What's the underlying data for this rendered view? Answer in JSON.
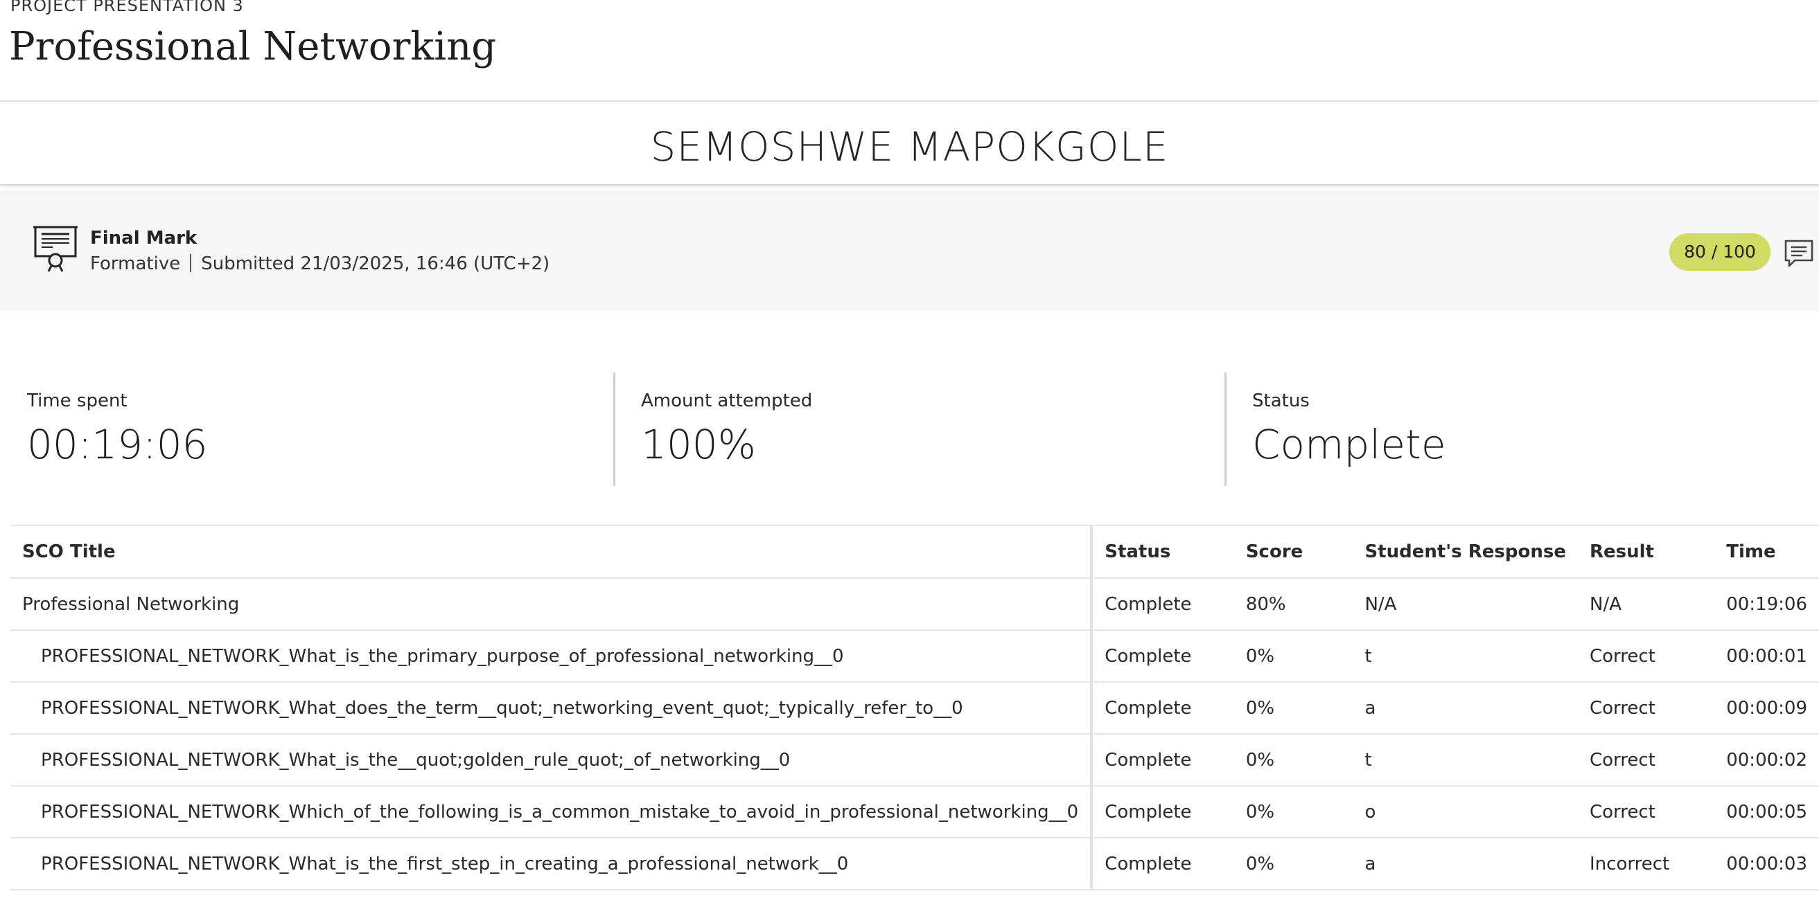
{
  "header": {
    "overline": "PROJECT PRESENTATION 3",
    "title": "Professional Networking"
  },
  "learner": {
    "name": "SEMOSHWE MAPOKGOLE"
  },
  "final_mark": {
    "icon": "certificate-presentation-icon",
    "label": "Final Mark",
    "assessment_type": "Formative",
    "submitted": "Submitted 21/03/2025, 16:46 (UTC+2)",
    "score": "80 / 100",
    "score_color": "#cfdc63",
    "comment_icon": "comment-icon"
  },
  "stats": {
    "time_spent_label": "Time spent",
    "time_spent_value": "00:19:06",
    "amount_label": "Amount attempted",
    "amount_value": "100%",
    "status_label": "Status",
    "status_value": "Complete"
  },
  "table": {
    "headers": [
      "SCO Title",
      "Status",
      "Score",
      "Student's Response",
      "Result",
      "Time"
    ],
    "rows": [
      [
        "Professional Networking",
        "Complete",
        "80%",
        "N/A",
        "N/A",
        "00:19:06"
      ],
      [
        "PROFESSIONAL_NETWORK_What_is_the_primary_purpose_of_professional_networking__0",
        "Complete",
        "0%",
        "t",
        "Correct",
        "00:00:01"
      ],
      [
        "PROFESSIONAL_NETWORK_What_does_the_term__quot;_networking_event_quot;_typically_refer_to__0",
        "Complete",
        "0%",
        "a",
        "Correct",
        "00:00:09"
      ],
      [
        "PROFESSIONAL_NETWORK_What_is_the__quot;golden_rule_quot;_of_networking__0",
        "Complete",
        "0%",
        "t",
        "Correct",
        "00:00:02"
      ],
      [
        "PROFESSIONAL_NETWORK_Which_of_the_following_is_a_common_mistake_to_avoid_in_professional_networking__0",
        "Complete",
        "0%",
        "o",
        "Correct",
        "00:00:05"
      ],
      [
        "PROFESSIONAL_NETWORK_What_is_the_first_step_in_creating_a_professional_network__0",
        "Complete",
        "0%",
        "a",
        "Incorrect",
        "00:00:03"
      ]
    ]
  }
}
